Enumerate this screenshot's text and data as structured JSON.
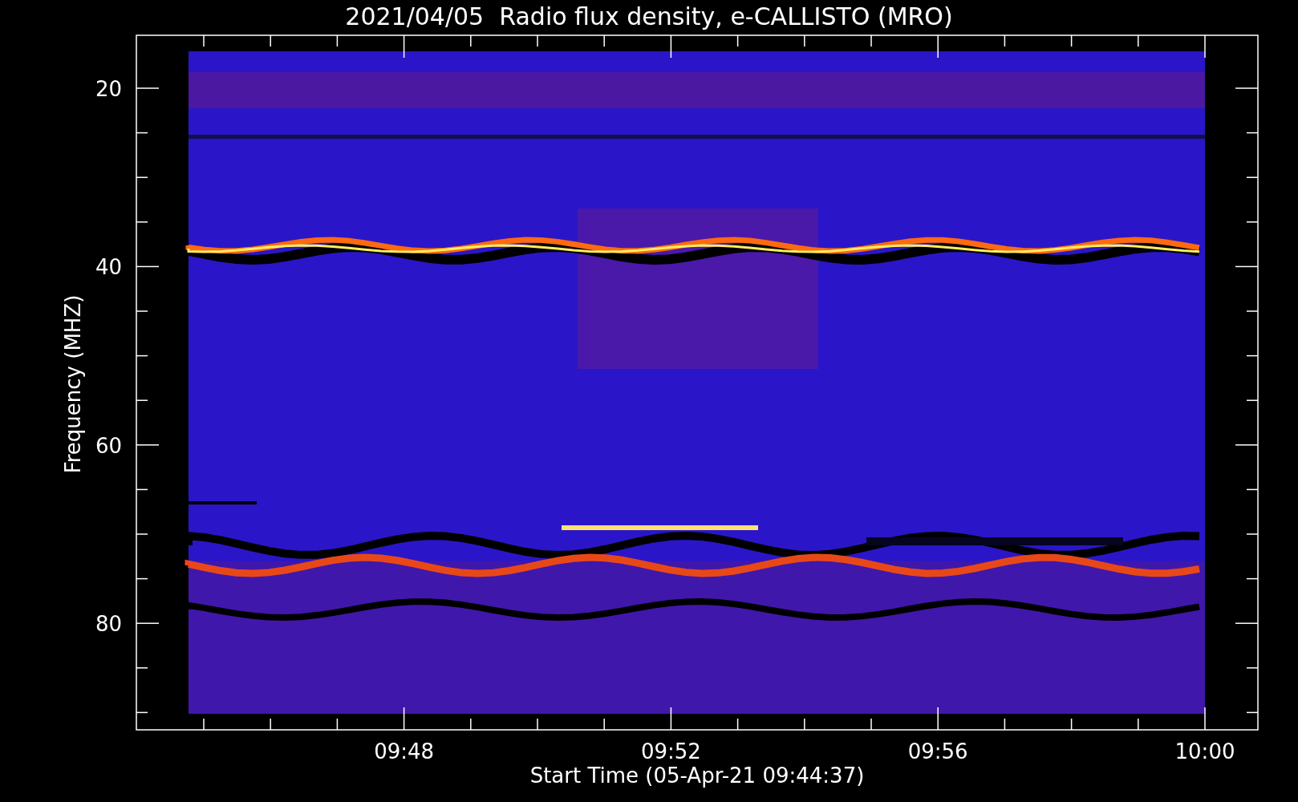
{
  "plot": {
    "title": "2021/04/05  Radio flux density, e-CALLISTO (MRO)",
    "ylabel": "Frequency (MHZ)",
    "xlabel": "Start Time (05-Apr-21 09:44:37)",
    "yticks": [
      {
        "label": "20"
      },
      {
        "label": "40"
      },
      {
        "label": "60"
      },
      {
        "label": "80"
      }
    ],
    "xticks": [
      {
        "label": "09:48"
      },
      {
        "label": "09:52"
      },
      {
        "label": "09:56"
      },
      {
        "label": "10:00"
      }
    ]
  }
}
